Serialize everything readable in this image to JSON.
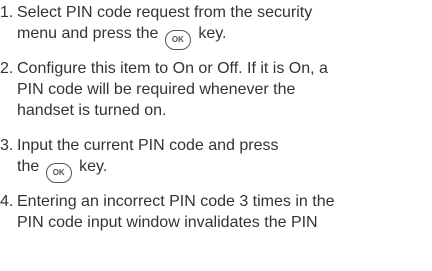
{
  "steps": [
    {
      "number": "1.",
      "line1": "Select PIN code request from the security",
      "line2_before": "menu and press the",
      "key_label": "OK",
      "line2_after": "key."
    },
    {
      "number": "2.",
      "line1": "Configure this item to On or Off. If it is On, a",
      "line2": "PIN code will be required whenever the",
      "line3": "handset is turned on."
    },
    {
      "number": "3.",
      "line1": "Input the current PIN code and press",
      "line2_before": "the",
      "key_label": "OK",
      "line2_after": "key."
    },
    {
      "number": "4.",
      "line1": "Entering an incorrect PIN code 3 times in the",
      "line2": "PIN code input window invalidates the PIN"
    }
  ]
}
